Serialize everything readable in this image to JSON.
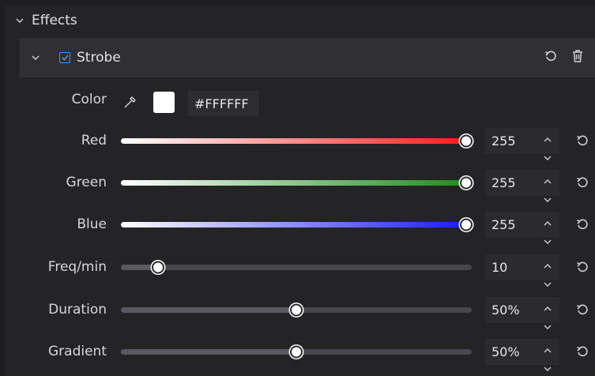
{
  "effects": {
    "title": "Effects"
  },
  "strobe": {
    "title": "Strobe",
    "enabled": true
  },
  "color": {
    "label": "Color",
    "hex": "#FFFFFF",
    "swatch": "#ffffff"
  },
  "sliders": [
    {
      "id": "red",
      "label": "Red",
      "value": "255",
      "fraction": 1.0,
      "gradient": "linear-gradient(90deg,#ffffff,#ff1a1a)"
    },
    {
      "id": "green",
      "label": "Green",
      "value": "255",
      "fraction": 1.0,
      "gradient": "linear-gradient(90deg,#ffffff,#1f8a1f)"
    },
    {
      "id": "blue",
      "label": "Blue",
      "value": "255",
      "fraction": 1.0,
      "gradient": "linear-gradient(90deg,#ffffff,#1a1aff)"
    },
    {
      "id": "freq",
      "label": "Freq/min",
      "value": "10",
      "fraction": 0.106
    },
    {
      "id": "duration",
      "label": "Duration",
      "value": "50%",
      "fraction": 0.5
    },
    {
      "id": "gradient",
      "label": "Gradient",
      "value": "50%",
      "fraction": 0.5
    }
  ],
  "icons": {
    "collapse": "chevron-down-icon",
    "reset": "reset-icon",
    "delete": "trash-icon",
    "eyedropper": "eyedropper-icon",
    "spin_up": "chevron-up-icon",
    "spin_down": "chevron-down-icon"
  }
}
